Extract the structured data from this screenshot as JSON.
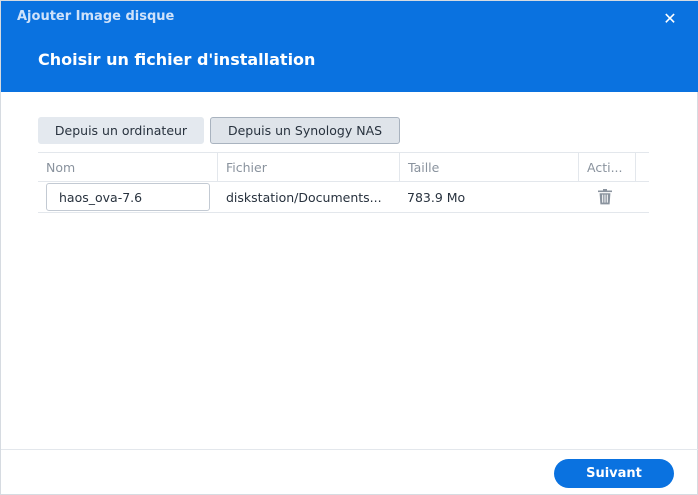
{
  "window": {
    "title": "Ajouter Image disque",
    "close_glyph": "✕"
  },
  "header": {
    "step_title": "Choisir un fichier d'installation"
  },
  "source_buttons": {
    "from_computer": "Depuis un ordinateur",
    "from_nas": "Depuis un Synology NAS"
  },
  "table": {
    "columns": [
      "Nom",
      "Fichier",
      "Taille",
      "Acti..."
    ],
    "rows": [
      {
        "name": "haos_ova-7.6",
        "file": "diskstation/Documents...",
        "size": "783.9 Mo",
        "action_icon": "trash-icon"
      }
    ]
  },
  "footer": {
    "next_label": "Suivant"
  },
  "colors": {
    "accent": "#0a72e0",
    "header_title": "#cfe2fa"
  }
}
